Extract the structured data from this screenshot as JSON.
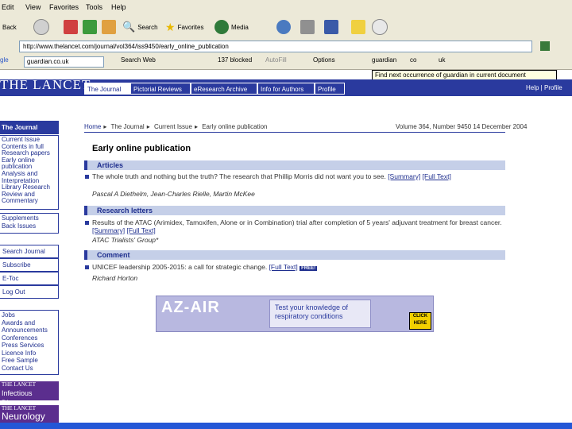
{
  "browser": {
    "menu": [
      "Edit",
      "View",
      "Favorites",
      "Tools",
      "Help"
    ],
    "toolbar": {
      "back": "Back",
      "search": "Search",
      "favorites": "Favorites",
      "media": "Media"
    },
    "address": "http://www.thelancet.com/journal/vol364/iss9450/early_online_publication",
    "google": {
      "search_value": "guardian.co.uk",
      "search_web": "Search Web",
      "blocked": "137 blocked",
      "autofill": "AutoFill",
      "options": "Options",
      "term1": "guardian",
      "term2": "co",
      "term3": "uk"
    },
    "tooltip": "Find next occurrence of guardian in current document"
  },
  "site": {
    "logo": "THE LANCET",
    "tabs": [
      "The Journal",
      "Pictorial Reviews",
      "eResearch Archive",
      "Info for Authors",
      "Profile"
    ],
    "help": "Help | Profile"
  },
  "sidebar": {
    "head": "The Journal",
    "group1": [
      "Current Issue",
      "Contents in full",
      "Research papers",
      "Early online",
      "publication",
      "Analysis and",
      "Interpretation",
      "Library Research",
      "Review and",
      "Commentary"
    ],
    "group2": [
      "Supplements",
      "Back Issues"
    ],
    "buttons": [
      "Search Journal",
      "Subscribe",
      "E-Toc",
      "Log Out"
    ],
    "group3": [
      "Jobs",
      "Awards and",
      "Announcements",
      "Conferences",
      "Press Services",
      "Licence Info",
      "Free Sample",
      "Contact Us"
    ],
    "promo1": {
      "brand": "THE LANCET",
      "name": "Infectious Diseases"
    },
    "promo2": {
      "brand": "THE LANCET",
      "name": "Neurology"
    }
  },
  "content": {
    "breadcrumb": [
      "Home",
      "The Journal",
      "Current Issue",
      "Early online publication"
    ],
    "volume": "Volume 364, Number 9450    14 December 2004",
    "title": "Early online publication",
    "sections": {
      "articles": {
        "heading": "Articles",
        "text": "The whole truth and nothing but the truth? The research that Phillip Morris did not want you to see.",
        "summary": "[Summary]",
        "fulltext": "[Full Text]",
        "authors": "Pascal A Diethelm, Jean-Charles Rielle, Martin McKee"
      },
      "research": {
        "heading": "Research letters",
        "text": "Results of the ATAC (Arimidex, Tamoxifen, Alone or in Combination) trial after completion of 5 years' adjuvant treatment for breast cancer.",
        "summary": "[Summary]",
        "fulltext": "[Full Text]",
        "authors": "ATAC Trialists' Group*"
      },
      "comment": {
        "heading": "Comment",
        "text": "UNICEF leadership 2005-2015: a call for strategic change.",
        "fulltext": "[Full Text]",
        "free": "FREE!",
        "authors": "Richard Horton"
      }
    },
    "ad": {
      "brand": "AZ-AIR",
      "text": "Test your knowledge of respiratory conditions",
      "cta": "CLICK HERE"
    }
  },
  "colors": {
    "lancet_blue": "#2a3a9e",
    "section_bg": "#c5cfe8",
    "promo_purple": "#5b2e8e",
    "chrome": "#ece9d8"
  }
}
